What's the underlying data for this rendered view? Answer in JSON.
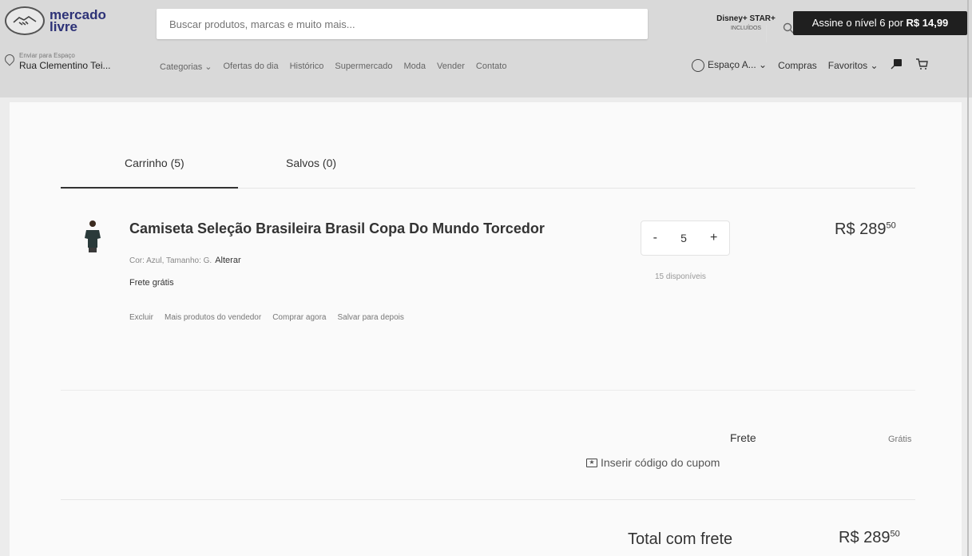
{
  "header": {
    "logo_text_line1": "mercado",
    "logo_text_line2": "livre",
    "search_placeholder": "Buscar produtos, marcas e muito mais...",
    "disney_line": "Disney+ STAR+",
    "disney_small": "INCLUÍDOS",
    "promo_text": "Assine o nível 6 por ",
    "promo_price": "R$ 14,99",
    "address_small": "Enviar para Espaço",
    "address_main": "Rua Clementino Tei...",
    "nav": [
      "Categorias ⌄",
      "Ofertas do dia",
      "Histórico",
      "Supermercado",
      "Moda",
      "Vender",
      "Contato"
    ],
    "user_label": "Espaço A... ⌄",
    "purchases_label": "Compras",
    "favorites_label": "Favoritos ⌄"
  },
  "tabs": {
    "cart": "Carrinho (5)",
    "saved": "Salvos (0)"
  },
  "item": {
    "title": "Camiseta Seleção Brasileira Brasil Copa Do Mundo Torcedor",
    "variant": "Cor: Azul, Tamanho: G.",
    "variant_change": "Alterar",
    "shipping": "Frete grátis",
    "actions": [
      "Excluir",
      "Mais produtos do vendedor",
      "Comprar agora",
      "Salvar para depois"
    ],
    "quantity": "5",
    "minus": "-",
    "plus": "+",
    "stock": "15 disponíveis",
    "price_int": "R$ 289",
    "price_cents": "50"
  },
  "summary": {
    "frete_label": "Frete",
    "frete_value": "Grátis",
    "coupon_label": "Inserir código do cupom",
    "total_label": "Total com frete",
    "total_int": "R$ 289",
    "total_cents": "50"
  },
  "colors": {
    "header_bg": "#d9d9d9",
    "promo_bg": "#1f1f1f",
    "logo_text": "#2d3277"
  }
}
